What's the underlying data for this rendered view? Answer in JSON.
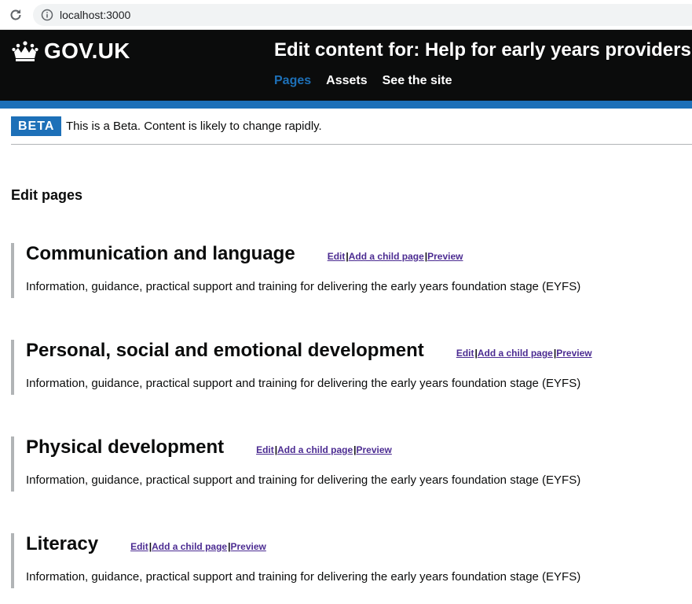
{
  "browser": {
    "url": "localhost:3000"
  },
  "header": {
    "logo_text": "GOV.UK",
    "service_title": "Edit content for: Help for early years providers",
    "nav": [
      {
        "label": "Pages",
        "active": true
      },
      {
        "label": "Assets",
        "active": false
      },
      {
        "label": "See the site",
        "active": false
      }
    ]
  },
  "beta": {
    "tag": "BETA",
    "text": "This is a Beta. Content is likely to change rapidly."
  },
  "main": {
    "heading": "Edit pages",
    "actions": {
      "edit": "Edit",
      "add_child": "Add a child page",
      "preview": "Preview",
      "separator": "|"
    },
    "pages": [
      {
        "title": "Communication and language",
        "description": "Information, guidance, practical support and training for delivering the early years foundation stage (EYFS)"
      },
      {
        "title": "Personal, social and emotional development",
        "description": "Information, guidance, practical support and training for delivering the early years foundation stage (EYFS)"
      },
      {
        "title": "Physical development",
        "description": "Information, guidance, practical support and training for delivering the early years foundation stage (EYFS)"
      },
      {
        "title": "Literacy",
        "description": "Information, guidance, practical support and training for delivering the early years foundation stage (EYFS)"
      }
    ]
  },
  "colors": {
    "header_bg": "#0b0c0c",
    "brand_blue": "#1d70b8",
    "visited_link": "#4c2c92",
    "border_grey": "#b1b4b6"
  },
  "icons": {
    "reload": "reload-icon",
    "info": "info-icon",
    "crown": "crown-icon"
  }
}
